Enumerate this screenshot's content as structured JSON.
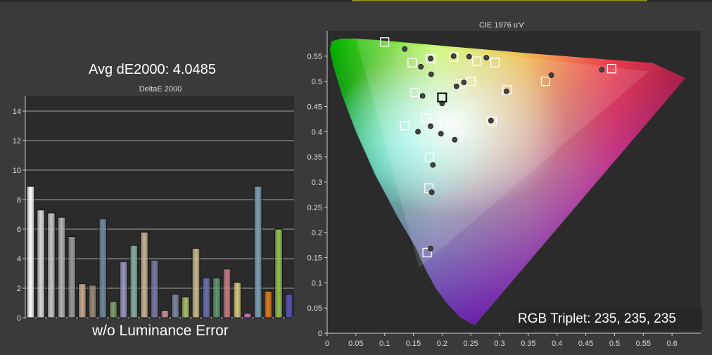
{
  "left_panel": {
    "title": "Avg dE2000: 4.0485",
    "footer": "w/o Luminance Error"
  },
  "right_panel": {
    "rgb_triplet": "RGB Triplet: 235, 235, 235"
  },
  "chart_data": [
    {
      "type": "bar",
      "title": "DeltaE 2000",
      "ylim": [
        0,
        15
      ],
      "yticks": [
        0,
        2,
        4,
        6,
        8,
        10,
        12,
        14
      ],
      "grid": true,
      "values": [
        8.9,
        7.3,
        7.1,
        6.8,
        5.5,
        2.3,
        2.2,
        6.7,
        1.1,
        3.8,
        4.9,
        5.8,
        3.9,
        0.5,
        1.6,
        1.4,
        4.7,
        2.7,
        2.7,
        3.3,
        2.4,
        0.3,
        8.9,
        1.8,
        6.0,
        1.6
      ],
      "colors": [
        "#ffffff",
        "#d9d9d9",
        "#c6c6c6",
        "#b3b3b3",
        "#999999",
        "#c9a98f",
        "#9b8978",
        "#708aa0",
        "#7f9f6a",
        "#9a98bf",
        "#86b0a2",
        "#c8b393",
        "#7b7aa3",
        "#c79098",
        "#7f86a2",
        "#a9c06f",
        "#caba8f",
        "#6a72b0",
        "#5e9a72",
        "#c47d82",
        "#d5c77e",
        "#c87ab6",
        "#7da0b3",
        "#dd7d1e",
        "#91c24e",
        "#5a52b8"
      ]
    },
    {
      "type": "scatter",
      "title": "CIE 1976 u'v'",
      "xlim": [
        0,
        0.65
      ],
      "ylim": [
        0,
        0.6
      ],
      "xticks": [
        0,
        0.05,
        0.1,
        0.15,
        0.2,
        0.25,
        0.3,
        0.35,
        0.4,
        0.45,
        0.5,
        0.55,
        0.6
      ],
      "yticks": [
        0,
        0.05,
        0.1,
        0.15,
        0.2,
        0.25,
        0.3,
        0.35,
        0.4,
        0.45,
        0.5,
        0.55
      ],
      "targets": [
        [
          0.1,
          0.578
        ],
        [
          0.148,
          0.537
        ],
        [
          0.18,
          0.545
        ],
        [
          0.22,
          0.548
        ],
        [
          0.26,
          0.54
        ],
        [
          0.292,
          0.537
        ],
        [
          0.495,
          0.525
        ],
        [
          0.38,
          0.5
        ],
        [
          0.313,
          0.483
        ],
        [
          0.25,
          0.5
        ],
        [
          0.232,
          0.495
        ],
        [
          0.153,
          0.478
        ],
        [
          0.2,
          0.468
        ],
        [
          0.135,
          0.412
        ],
        [
          0.172,
          0.427
        ],
        [
          0.19,
          0.413
        ],
        [
          0.287,
          0.421
        ],
        [
          0.228,
          0.39
        ],
        [
          0.178,
          0.349
        ],
        [
          0.177,
          0.288
        ],
        [
          0.174,
          0.16
        ]
      ],
      "measured": [
        [
          0.135,
          0.564
        ],
        [
          0.163,
          0.529
        ],
        [
          0.181,
          0.514
        ],
        [
          0.18,
          0.545
        ],
        [
          0.22,
          0.55
        ],
        [
          0.247,
          0.549
        ],
        [
          0.277,
          0.547
        ],
        [
          0.478,
          0.523
        ],
        [
          0.39,
          0.512
        ],
        [
          0.312,
          0.48
        ],
        [
          0.238,
          0.498
        ],
        [
          0.225,
          0.49
        ],
        [
          0.166,
          0.471
        ],
        [
          0.2,
          0.456
        ],
        [
          0.18,
          0.411
        ],
        [
          0.158,
          0.4
        ],
        [
          0.198,
          0.396
        ],
        [
          0.285,
          0.422
        ],
        [
          0.222,
          0.384
        ],
        [
          0.184,
          0.334
        ],
        [
          0.182,
          0.28
        ],
        [
          0.18,
          0.168
        ]
      ]
    }
  ]
}
